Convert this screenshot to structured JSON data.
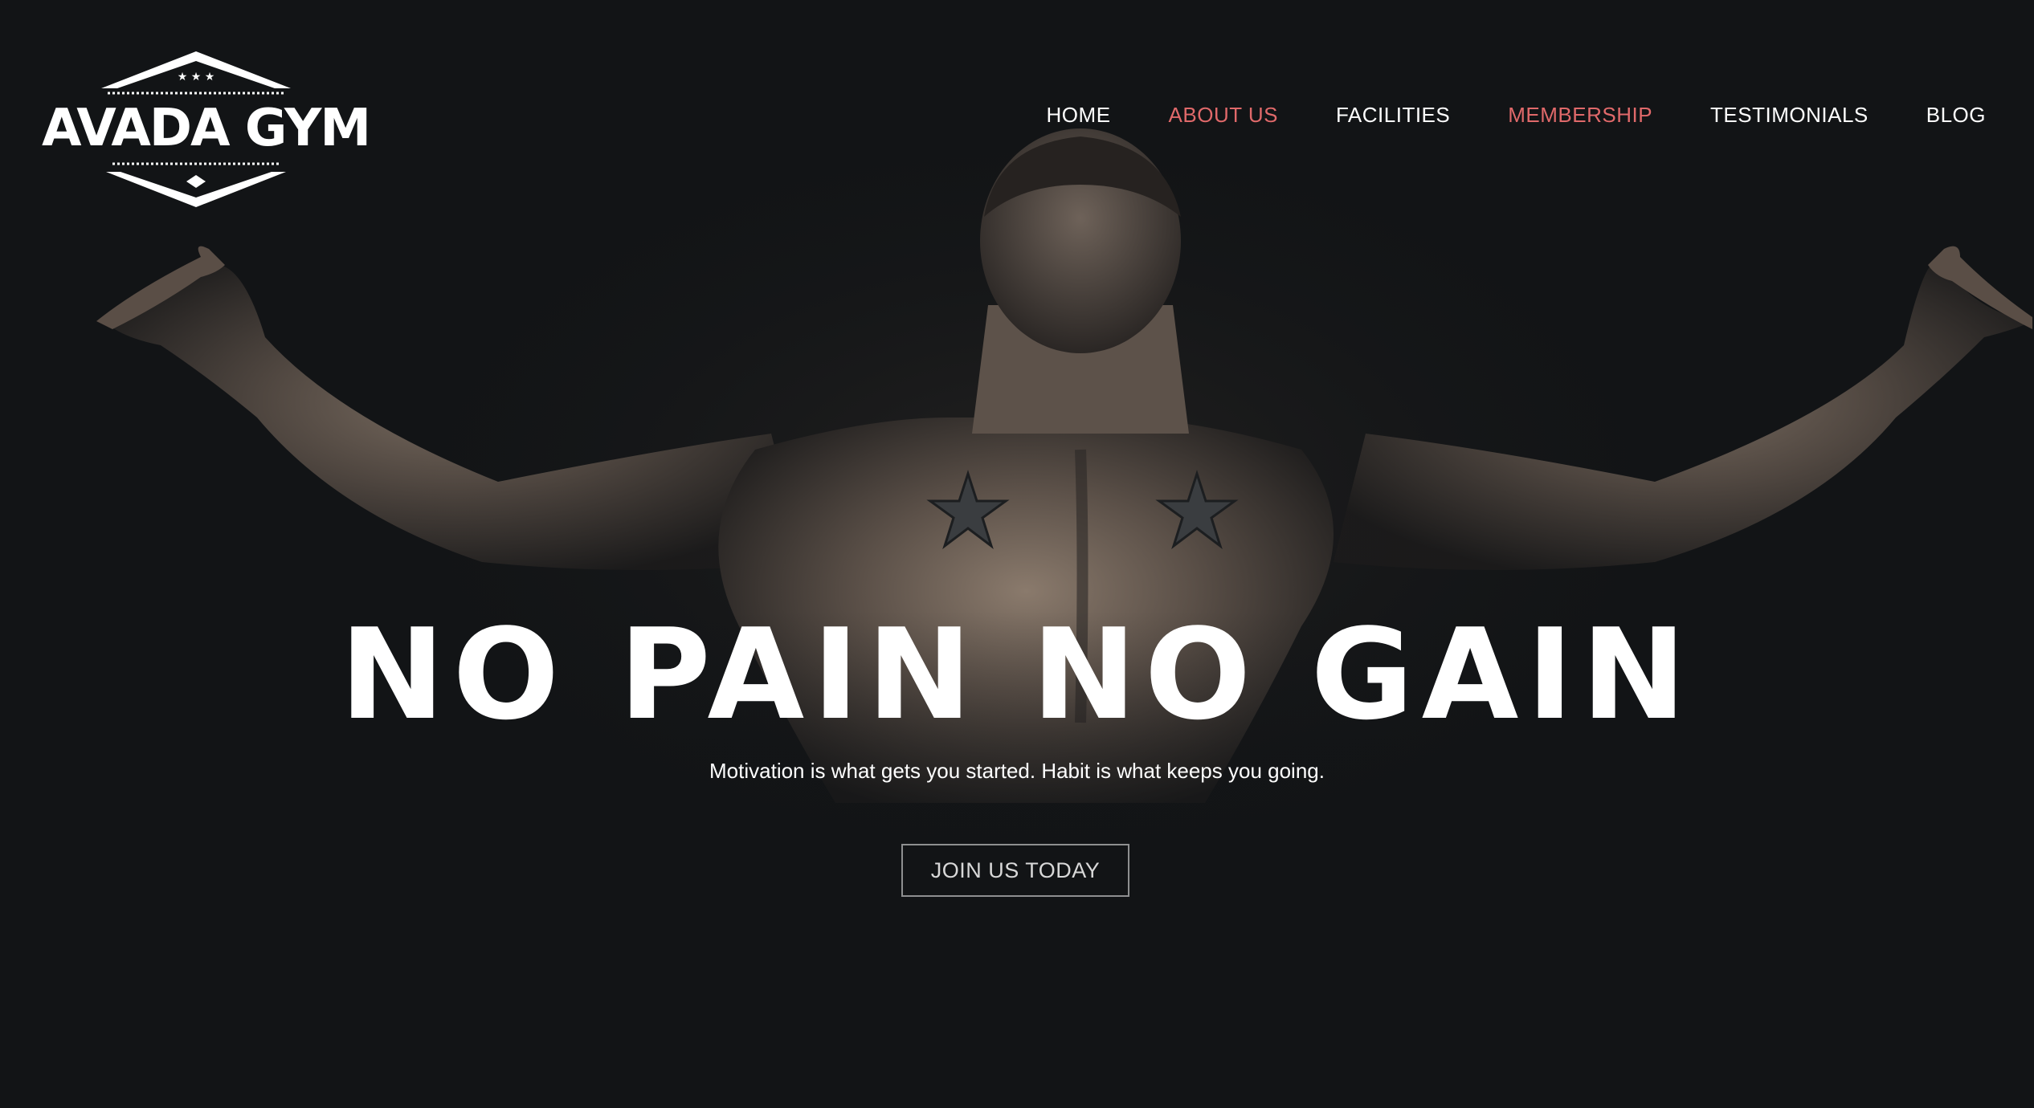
{
  "brand": {
    "logo_text": "AVADA GYM",
    "logo_icon": "diamond-badge-icon"
  },
  "nav": {
    "items": [
      {
        "label": "HOME",
        "active": false
      },
      {
        "label": "ABOUT US",
        "active": true
      },
      {
        "label": "FACILITIES",
        "active": false
      },
      {
        "label": "MEMBERSHIP",
        "active": true
      },
      {
        "label": "TESTIMONIALS",
        "active": false
      },
      {
        "label": "BLOG",
        "active": false
      }
    ]
  },
  "hero": {
    "title": "NO PAIN NO GAIN",
    "subtitle": "Motivation is what gets you started. Habit is what keeps you going.",
    "cta_label": "JOIN US TODAY",
    "image_icon": "athlete-back-image"
  },
  "colors": {
    "background": "#121416",
    "accent": "#e0696a",
    "text": "#ffffff"
  }
}
